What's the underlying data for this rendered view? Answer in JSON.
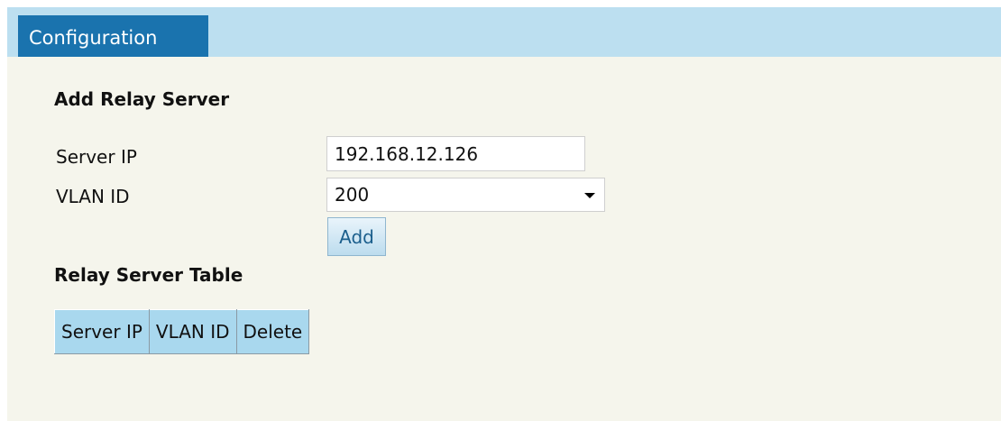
{
  "tabs": [
    {
      "label": "Configuration",
      "active": true
    }
  ],
  "add_relay": {
    "title": "Add Relay Server",
    "server_ip_label": "Server IP",
    "server_ip_value": "192.168.12.126",
    "vlan_id_label": "VLAN ID",
    "vlan_id_selected": "200",
    "add_button": "Add"
  },
  "relay_table": {
    "title": "Relay Server Table",
    "columns": [
      "Server IP",
      "VLAN ID",
      "Delete"
    ],
    "rows": []
  },
  "colors": {
    "tab_bar": "#bcdff0",
    "tab_active": "#1a73ae",
    "panel_background": "#f5f5ec",
    "table_header": "#a9d8ee"
  },
  "icons": {
    "select_arrow": "chevron-down-icon"
  }
}
